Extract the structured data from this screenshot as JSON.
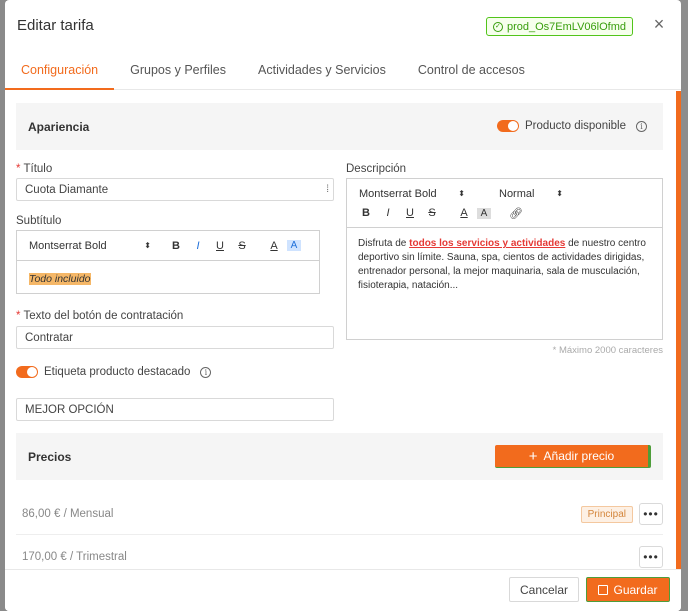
{
  "modal": {
    "title": "Editar tarifa",
    "product_id": "prod_Os7EmLV06lOfmd",
    "close_label": "×"
  },
  "tabs": [
    {
      "label": "Configuración",
      "active": true
    },
    {
      "label": "Grupos y Perfiles",
      "active": false
    },
    {
      "label": "Actividades y Servicios",
      "active": false
    },
    {
      "label": "Control de accesos",
      "active": false
    }
  ],
  "appearance": {
    "title": "Apariencia",
    "available_label": "Producto disponible",
    "available": true
  },
  "form": {
    "title_label": "Título",
    "title_value": "Cuota Diamante",
    "subtitle_label": "Subtítulo",
    "subtitle_font": "Montserrat Bold",
    "subtitle_value": "Todo incluido",
    "cta_label": "Texto del botón de contratación",
    "cta_value": "Contratar",
    "featured_label": "Etiqueta producto destacado",
    "featured": true,
    "featured_value": "MEJOR OPCIÓN",
    "description_label": "Descripción",
    "description_font": "Montserrat Bold",
    "description_size": "Normal",
    "description_prefix": "Disfruta de ",
    "description_highlight": "todos los servicios y actividades",
    "description_rest": " de nuestro centro deportivo sin límite. Sauna, spa, cientos de actividades dirigidas, entrenador personal, la mejor maquinaria, sala de musculación, fisioterapia, natación...",
    "description_hint": "* Máximo 2000 caracteres"
  },
  "prices": {
    "title": "Precios",
    "add_label": "Añadir precio",
    "items": [
      {
        "label": "86,00 € / Mensual",
        "badge": "Principal"
      },
      {
        "label": "170,00 € / Trimestral",
        "badge": ""
      }
    ]
  },
  "toolbar": {
    "bold": "B",
    "italic": "I",
    "underline": "U",
    "strike": "S",
    "color": "A",
    "bg": "A",
    "more": "•••"
  },
  "footer": {
    "cancel_label": "Cancelar",
    "save_label": "Guardar"
  },
  "colors": {
    "accent": "#f26b1d",
    "success": "#389e0d",
    "danger": "#e53935"
  }
}
